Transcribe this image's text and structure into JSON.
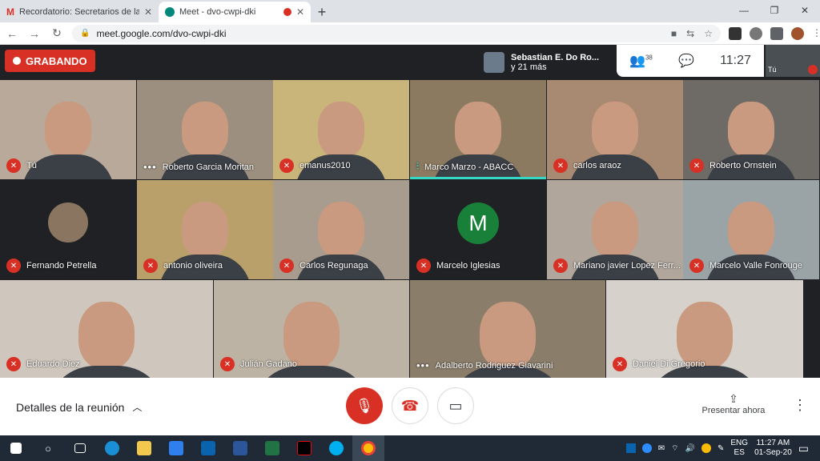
{
  "browser": {
    "tabs": [
      {
        "title": "Recordatorio: Secretarios de la A",
        "active": false,
        "icon": "gmail-icon"
      },
      {
        "title": "Meet - dvo-cwpi-dki",
        "active": true,
        "icon": "meet-icon"
      }
    ],
    "url": "meet.google.com/dvo-cwpi-dki",
    "new_tab": "+",
    "min": "—",
    "max": "❐",
    "close": "✕"
  },
  "meet": {
    "recording_label": "GRABANDO",
    "presenter_name": "Sebastian E. Do Ro...",
    "presenter_more": "y 21 más",
    "participants_count": "38",
    "time": "11:27",
    "self_label": "Tú",
    "tiles": [
      {
        "name": "Tú",
        "status": "muted",
        "bg": "#b8a99a"
      },
      {
        "name": "Roberto Garcia Moritan",
        "status": "dots",
        "bg": "#9c8f80"
      },
      {
        "name": "emanus2010",
        "status": "muted",
        "bg": "#c9b47a"
      },
      {
        "name": "Marco Marzo - ABACC",
        "status": "speaking",
        "bg": "#8c7a60"
      },
      {
        "name": "carlos araoz",
        "status": "muted",
        "bg": "#a88a72"
      },
      {
        "name": "Roberto Ornstein",
        "status": "muted",
        "bg": "#6e6a66"
      },
      {
        "name": "Fernando Petrella",
        "status": "muted",
        "bg": "#202124"
      },
      {
        "name": "antonio oliveira",
        "status": "muted",
        "bg": "#b9a06a"
      },
      {
        "name": "Carlos Regunaga",
        "status": "muted",
        "bg": "#a79c8d"
      },
      {
        "name": "Marcelo Iglesias",
        "status": "muted",
        "bg": "#202124",
        "initial": "M"
      },
      {
        "name": "Mariano javier Lopez Ferr...",
        "status": "muted",
        "bg": "#b0a69c"
      },
      {
        "name": "Marcelo Valle Fonrouge",
        "status": "muted",
        "bg": "#9aa3a6"
      },
      {
        "name": "Eduardo Diez",
        "status": "muted",
        "bg": "#cfc7bd"
      },
      {
        "name": "Julián Gadano",
        "status": "muted",
        "bg": "#bcb3a4"
      },
      {
        "name": "Adalberto Rodriguez Giavarini",
        "status": "dots",
        "bg": "#8a7d6a"
      },
      {
        "name": "Daniel Di Gregorio",
        "status": "muted",
        "bg": "#d6d2cb"
      }
    ],
    "details_label": "Detalles de la reunión",
    "present_label": "Presentar ahora"
  },
  "taskbar": {
    "lang_top": "ENG",
    "lang_bottom": "ES",
    "clock_time": "11:27 AM",
    "clock_date": "01-Sep-20"
  }
}
